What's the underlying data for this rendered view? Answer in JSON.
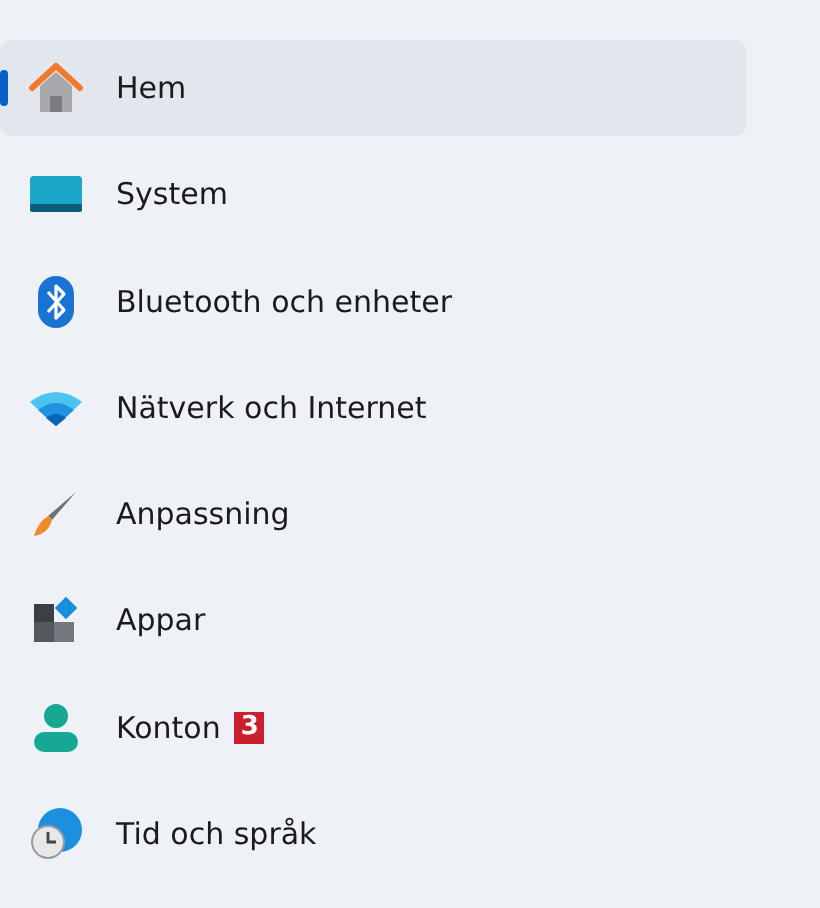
{
  "sidebar": {
    "items": [
      {
        "label": "Hem",
        "selected": true
      },
      {
        "label": "System",
        "selected": false
      },
      {
        "label": "Bluetooth och enheter",
        "selected": false
      },
      {
        "label": "Nätverk och Internet",
        "selected": false
      },
      {
        "label": "Anpassning",
        "selected": false
      },
      {
        "label": "Appar",
        "selected": false
      },
      {
        "label": "Konton",
        "selected": false,
        "badge": "3"
      },
      {
        "label": "Tid och språk",
        "selected": false
      }
    ]
  }
}
